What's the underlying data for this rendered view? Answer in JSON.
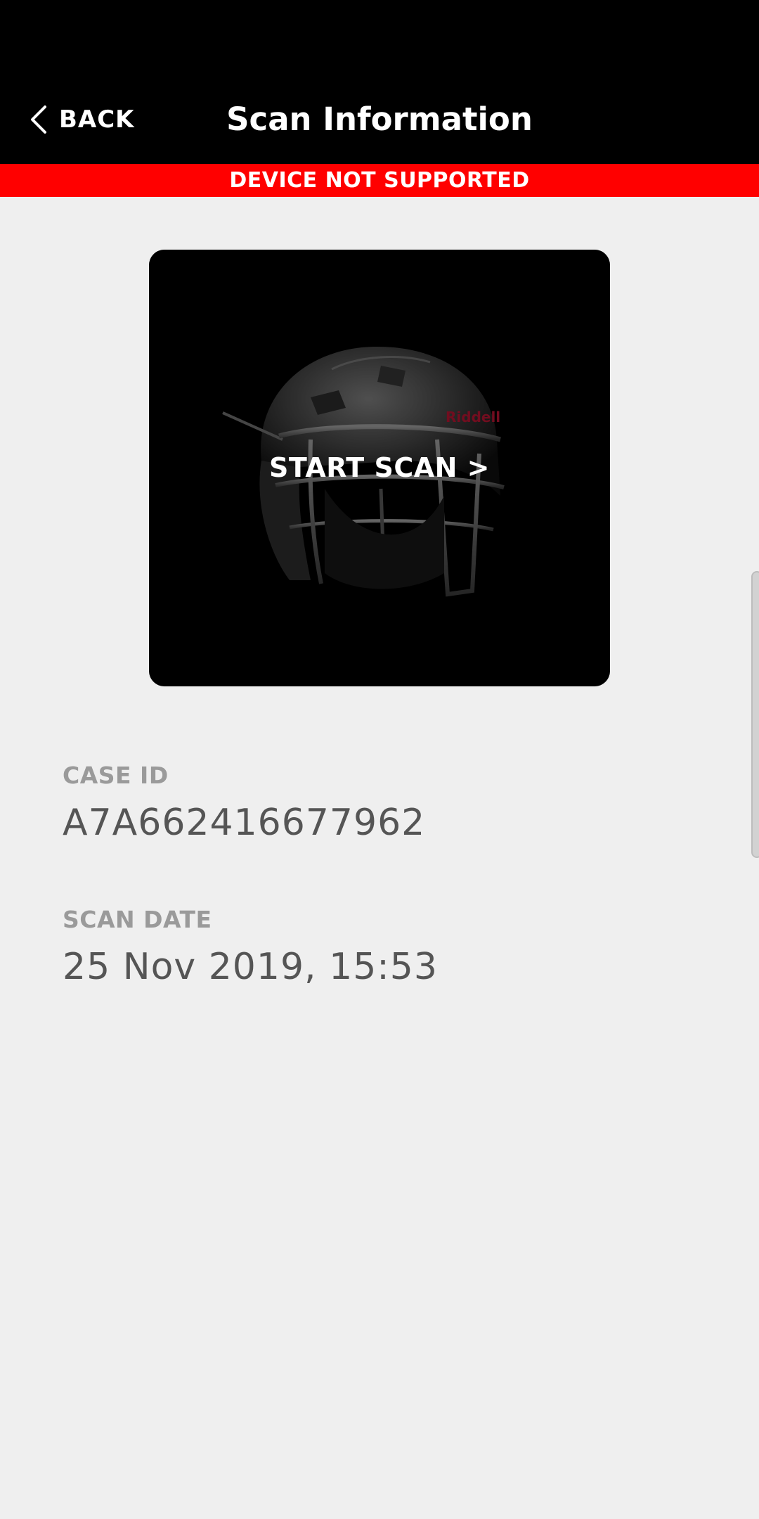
{
  "header": {
    "back_label": "BACK",
    "title": "Scan Information"
  },
  "banner": {
    "text": "DEVICE NOT SUPPORTED"
  },
  "scan_card": {
    "action_label": "START SCAN  >",
    "helmet_brand": "Riddell"
  },
  "details": {
    "case_id_label": "CASE ID",
    "case_id_value": "A7A662416677962",
    "scan_date_label": "SCAN DATE",
    "scan_date_value": "25 Nov 2019, 15:53"
  },
  "colors": {
    "appbar": "#000000",
    "banner": "#ff0000",
    "background": "#efefef",
    "label": "#9a9a9a",
    "value": "#555555"
  }
}
